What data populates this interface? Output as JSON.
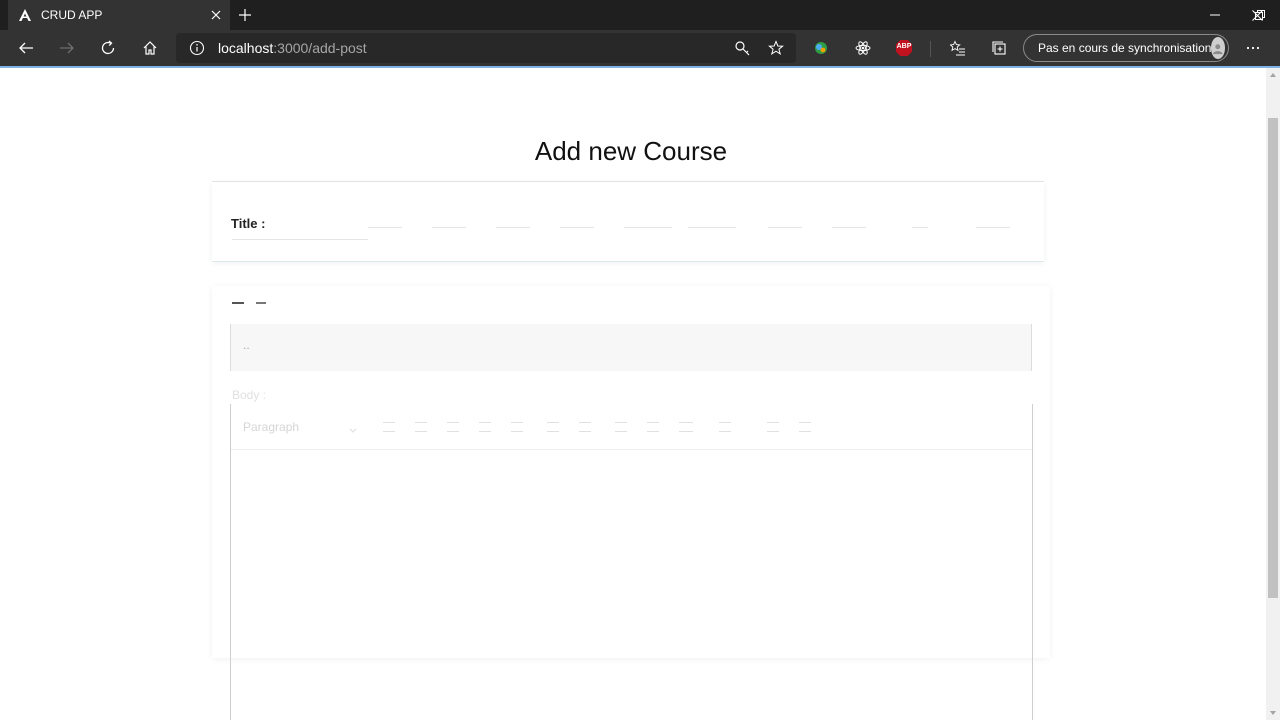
{
  "browser": {
    "tab_title": "CRUD APP",
    "url_host": "localhost",
    "url_rest": ":3000/add-post",
    "sync_label": "Pas en cours de synchronisation",
    "adblock_label": "ABP"
  },
  "page": {
    "title": "Add new Course",
    "title_label": "Title :",
    "input_value": "..",
    "body_label": "Body :",
    "editor": {
      "heading_select": "Paragraph"
    }
  }
}
